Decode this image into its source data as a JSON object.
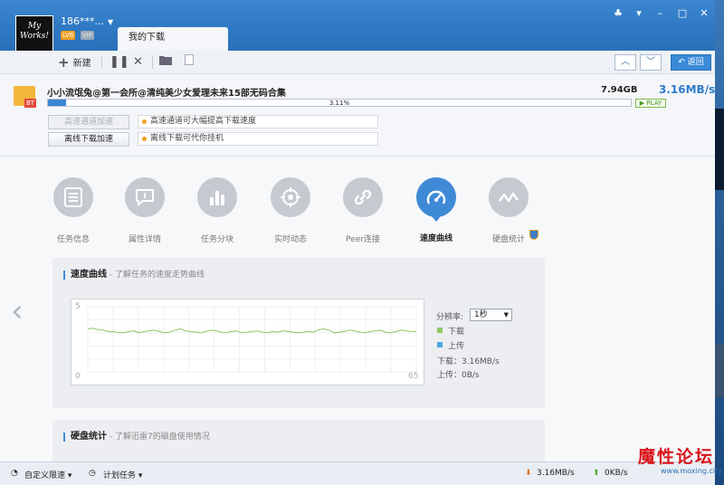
{
  "user": {
    "name": "186***...",
    "level": "LV6",
    "vip": "VIP",
    "avatar_text": "My Works!"
  },
  "tab": {
    "label": "我的下载"
  },
  "toolbar": {
    "new_label": "新建",
    "back_label": "返回"
  },
  "task": {
    "name": "小小流氓兔@第一会所@清纯美少女爱理未来15部无码合集",
    "size": "7.94GB",
    "speed": "3.16MB/s",
    "progress_text": "3.11%",
    "progress": 3.11,
    "type_tag": "BT",
    "play_label": "PLAY",
    "accel_button": "高速通道加速",
    "offline_button": "离线下载加速",
    "accel_tip": "高速通道可大幅提高下载速度",
    "offline_tip": "离线下载可代你挂机"
  },
  "detail_tabs": [
    {
      "label": "任务信息",
      "icon": "list-icon"
    },
    {
      "label": "属性详情",
      "icon": "chat-icon"
    },
    {
      "label": "任务分块",
      "icon": "bars-icon"
    },
    {
      "label": "实时动态",
      "icon": "target-icon"
    },
    {
      "label": "Peer连接",
      "icon": "link-icon"
    },
    {
      "label": "速度曲线",
      "icon": "speedometer-icon",
      "active": true
    },
    {
      "label": "硬盘统计",
      "icon": "wave-icon"
    }
  ],
  "speed_panel": {
    "title": "速度曲线",
    "subtitle": " - 了解任务的速度走势曲线",
    "resolution_label": "分辨率:",
    "resolution_value": "1秒",
    "legend_download": "下载",
    "legend_upload": "上传",
    "download_value": "下载：3.16MB/s",
    "upload_value": "上传：0B/s",
    "axis_top": "5",
    "axis_bottom": "0",
    "axis_right": "65",
    "colors": {
      "download": "#8cc861",
      "upload": "#4aa8e0"
    }
  },
  "chart_data": {
    "type": "line",
    "ylim": [
      0,
      5
    ],
    "xlim": [
      0,
      65
    ],
    "series": [
      {
        "name": "下载",
        "values": [
          3.3,
          3.35,
          3.25,
          3.2,
          3.1,
          3.1,
          3.0,
          3.0,
          3.1,
          3.15,
          3.0,
          3.1,
          3.15,
          3.2,
          3.1,
          3.0,
          3.05,
          3.2,
          3.3,
          3.15,
          3.1,
          3.05,
          3.0,
          3.1,
          3.2,
          3.15,
          3.05,
          3.0,
          3.1,
          3.15,
          3.0,
          3.05,
          3.1,
          3.15,
          3.05,
          3.0,
          3.1,
          3.05,
          3.15,
          3.1,
          3.05,
          3.0,
          3.05,
          3.1,
          3.05,
          3.25,
          3.3,
          3.2,
          3.0,
          3.05,
          3.1,
          3.2,
          3.15,
          3.05,
          3.0,
          3.1,
          3.15,
          3.2,
          3.05,
          3.0,
          3.1,
          3.2,
          3.15,
          3.1,
          3.1
        ]
      }
    ]
  },
  "disk_panel": {
    "title": "硬盘统计",
    "subtitle": " - 了解迅雷7的磁盘使用情况"
  },
  "statusbar": {
    "custom_limit": "自定义限速",
    "plan_task": "计划任务",
    "down_speed": "3.16MB/s",
    "up_speed": "0KB/s"
  },
  "watermark": {
    "text": "魔性论坛",
    "url": "www.moxing.city"
  }
}
